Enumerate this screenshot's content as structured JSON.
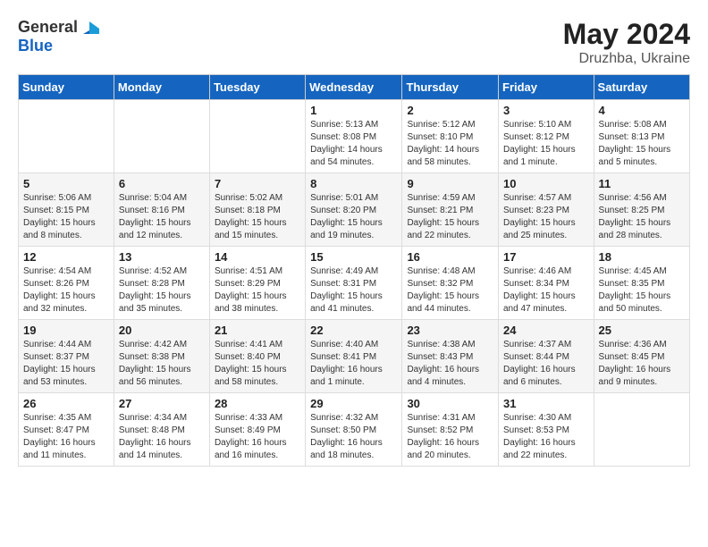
{
  "logo": {
    "general": "General",
    "blue": "Blue"
  },
  "title": {
    "month_year": "May 2024",
    "location": "Druzhba, Ukraine"
  },
  "weekdays": [
    "Sunday",
    "Monday",
    "Tuesday",
    "Wednesday",
    "Thursday",
    "Friday",
    "Saturday"
  ],
  "weeks": [
    [
      {
        "day": "",
        "info": ""
      },
      {
        "day": "",
        "info": ""
      },
      {
        "day": "",
        "info": ""
      },
      {
        "day": "1",
        "info": "Sunrise: 5:13 AM\nSunset: 8:08 PM\nDaylight: 14 hours and 54 minutes."
      },
      {
        "day": "2",
        "info": "Sunrise: 5:12 AM\nSunset: 8:10 PM\nDaylight: 14 hours and 58 minutes."
      },
      {
        "day": "3",
        "info": "Sunrise: 5:10 AM\nSunset: 8:12 PM\nDaylight: 15 hours and 1 minute."
      },
      {
        "day": "4",
        "info": "Sunrise: 5:08 AM\nSunset: 8:13 PM\nDaylight: 15 hours and 5 minutes."
      }
    ],
    [
      {
        "day": "5",
        "info": "Sunrise: 5:06 AM\nSunset: 8:15 PM\nDaylight: 15 hours and 8 minutes."
      },
      {
        "day": "6",
        "info": "Sunrise: 5:04 AM\nSunset: 8:16 PM\nDaylight: 15 hours and 12 minutes."
      },
      {
        "day": "7",
        "info": "Sunrise: 5:02 AM\nSunset: 8:18 PM\nDaylight: 15 hours and 15 minutes."
      },
      {
        "day": "8",
        "info": "Sunrise: 5:01 AM\nSunset: 8:20 PM\nDaylight: 15 hours and 19 minutes."
      },
      {
        "day": "9",
        "info": "Sunrise: 4:59 AM\nSunset: 8:21 PM\nDaylight: 15 hours and 22 minutes."
      },
      {
        "day": "10",
        "info": "Sunrise: 4:57 AM\nSunset: 8:23 PM\nDaylight: 15 hours and 25 minutes."
      },
      {
        "day": "11",
        "info": "Sunrise: 4:56 AM\nSunset: 8:25 PM\nDaylight: 15 hours and 28 minutes."
      }
    ],
    [
      {
        "day": "12",
        "info": "Sunrise: 4:54 AM\nSunset: 8:26 PM\nDaylight: 15 hours and 32 minutes."
      },
      {
        "day": "13",
        "info": "Sunrise: 4:52 AM\nSunset: 8:28 PM\nDaylight: 15 hours and 35 minutes."
      },
      {
        "day": "14",
        "info": "Sunrise: 4:51 AM\nSunset: 8:29 PM\nDaylight: 15 hours and 38 minutes."
      },
      {
        "day": "15",
        "info": "Sunrise: 4:49 AM\nSunset: 8:31 PM\nDaylight: 15 hours and 41 minutes."
      },
      {
        "day": "16",
        "info": "Sunrise: 4:48 AM\nSunset: 8:32 PM\nDaylight: 15 hours and 44 minutes."
      },
      {
        "day": "17",
        "info": "Sunrise: 4:46 AM\nSunset: 8:34 PM\nDaylight: 15 hours and 47 minutes."
      },
      {
        "day": "18",
        "info": "Sunrise: 4:45 AM\nSunset: 8:35 PM\nDaylight: 15 hours and 50 minutes."
      }
    ],
    [
      {
        "day": "19",
        "info": "Sunrise: 4:44 AM\nSunset: 8:37 PM\nDaylight: 15 hours and 53 minutes."
      },
      {
        "day": "20",
        "info": "Sunrise: 4:42 AM\nSunset: 8:38 PM\nDaylight: 15 hours and 56 minutes."
      },
      {
        "day": "21",
        "info": "Sunrise: 4:41 AM\nSunset: 8:40 PM\nDaylight: 15 hours and 58 minutes."
      },
      {
        "day": "22",
        "info": "Sunrise: 4:40 AM\nSunset: 8:41 PM\nDaylight: 16 hours and 1 minute."
      },
      {
        "day": "23",
        "info": "Sunrise: 4:38 AM\nSunset: 8:43 PM\nDaylight: 16 hours and 4 minutes."
      },
      {
        "day": "24",
        "info": "Sunrise: 4:37 AM\nSunset: 8:44 PM\nDaylight: 16 hours and 6 minutes."
      },
      {
        "day": "25",
        "info": "Sunrise: 4:36 AM\nSunset: 8:45 PM\nDaylight: 16 hours and 9 minutes."
      }
    ],
    [
      {
        "day": "26",
        "info": "Sunrise: 4:35 AM\nSunset: 8:47 PM\nDaylight: 16 hours and 11 minutes."
      },
      {
        "day": "27",
        "info": "Sunrise: 4:34 AM\nSunset: 8:48 PM\nDaylight: 16 hours and 14 minutes."
      },
      {
        "day": "28",
        "info": "Sunrise: 4:33 AM\nSunset: 8:49 PM\nDaylight: 16 hours and 16 minutes."
      },
      {
        "day": "29",
        "info": "Sunrise: 4:32 AM\nSunset: 8:50 PM\nDaylight: 16 hours and 18 minutes."
      },
      {
        "day": "30",
        "info": "Sunrise: 4:31 AM\nSunset: 8:52 PM\nDaylight: 16 hours and 20 minutes."
      },
      {
        "day": "31",
        "info": "Sunrise: 4:30 AM\nSunset: 8:53 PM\nDaylight: 16 hours and 22 minutes."
      },
      {
        "day": "",
        "info": ""
      }
    ]
  ]
}
